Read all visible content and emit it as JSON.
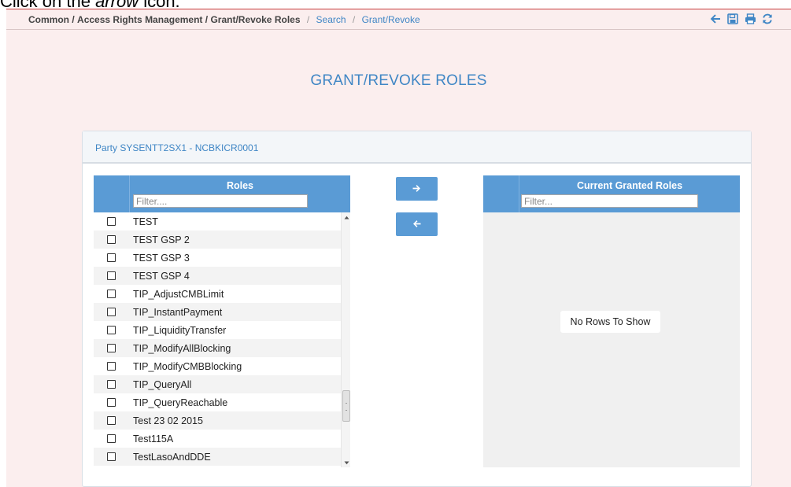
{
  "instruction": {
    "prefix": "Click on the ",
    "emphasis": "arrow",
    "suffix": " icon."
  },
  "breadcrumb": {
    "items": [
      "Common",
      "Access Rights Management",
      "Grant/Revoke Roles"
    ],
    "links": [
      "Search",
      "Grant/Revoke"
    ],
    "separator": "/"
  },
  "toolbar": {
    "icons": [
      "back-arrow-icon",
      "save-icon",
      "print-icon",
      "refresh-icon"
    ],
    "icon_color": "#3f86c5"
  },
  "page": {
    "title": "GRANT/REVOKE ROLES"
  },
  "panel": {
    "header": "Party SYSENTT2SX1 - NCBKICR0001"
  },
  "roles_grid": {
    "title": "Roles",
    "filter_placeholder": "Filter....",
    "rows": [
      "TEST",
      "TEST GSP 2",
      "TEST GSP 3",
      "TEST GSP 4",
      "TIP_AdjustCMBLimit",
      "TIP_InstantPayment",
      "TIP_LiquidityTransfer",
      "TIP_ModifyAllBlocking",
      "TIP_ModifyCMBBlocking",
      "TIP_QueryAll",
      "TIP_QueryReachable",
      "Test 23 02 2015",
      "Test115A",
      "TestLasoAndDDE"
    ]
  },
  "buttons": {
    "grant_icon": "arrow-right-icon",
    "revoke_icon": "arrow-left-icon"
  },
  "granted_grid": {
    "title": "Current Granted Roles",
    "filter_placeholder": "Filter...",
    "empty_message": "No Rows To Show"
  },
  "colors": {
    "accent": "#5a9bd5",
    "link": "#3f86c5",
    "page_background": "#fbeeee",
    "top_border": "#c73b3b"
  }
}
